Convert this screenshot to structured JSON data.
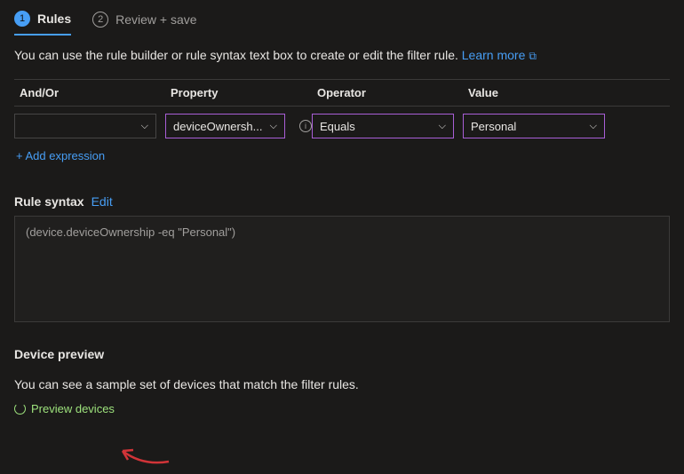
{
  "tabs": {
    "rules": {
      "num": "1",
      "label": "Rules"
    },
    "review": {
      "num": "2",
      "label": "Review + save"
    }
  },
  "description": {
    "text": "You can use the rule builder or rule syntax text box to create or edit the filter rule.",
    "learn_more": "Learn more"
  },
  "columns": {
    "andor": "And/Or",
    "property": "Property",
    "operator": "Operator",
    "value": "Value"
  },
  "row": {
    "andor": "",
    "property": "deviceOwnersh...",
    "operator": "Equals",
    "value": "Personal"
  },
  "add_expression": "+ Add expression",
  "rule_syntax": {
    "title": "Rule syntax",
    "edit": "Edit",
    "content": "(device.deviceOwnership -eq \"Personal\")"
  },
  "device_preview": {
    "title": "Device preview",
    "desc": "You can see a sample set of devices that match the filter rules.",
    "link": "Preview devices"
  }
}
